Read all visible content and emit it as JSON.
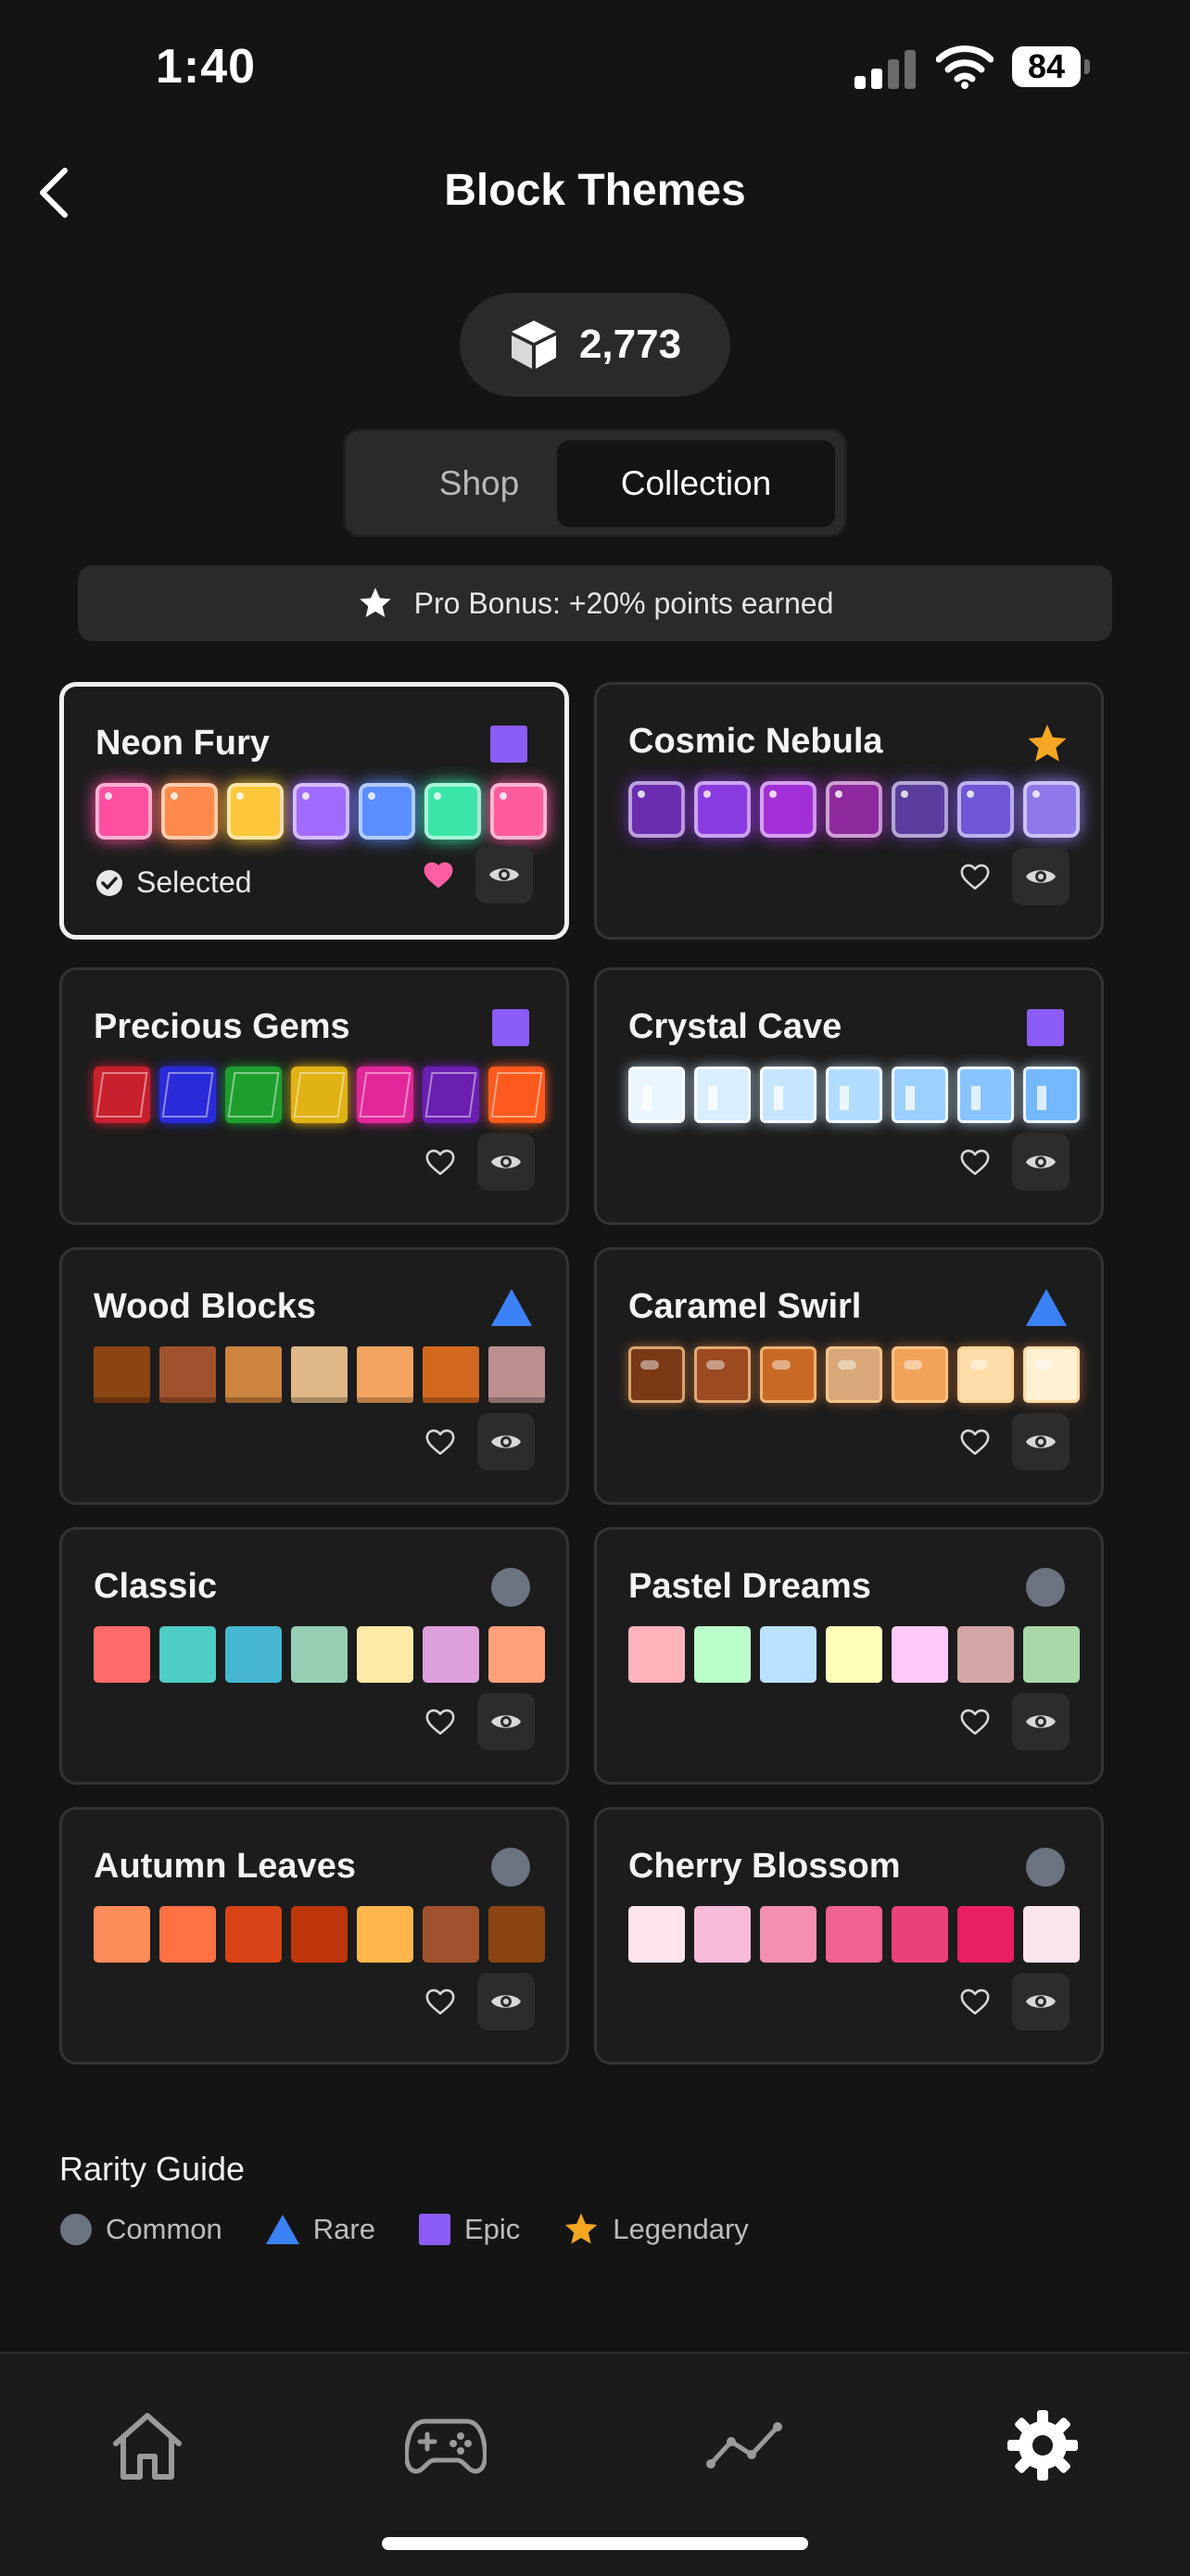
{
  "status_bar": {
    "time": "1:40",
    "battery": "84"
  },
  "header": {
    "title": "Block Themes"
  },
  "points": {
    "value": "2,773"
  },
  "segments": {
    "shop": "Shop",
    "collection": "Collection"
  },
  "bonus": {
    "text": "Pro Bonus: +20% points earned"
  },
  "colors": {
    "epic": "#8B5CF6",
    "rare": "#3B82F6",
    "legendary": "#F5A623",
    "common": "#6B7280",
    "favorite": "#FF5FA2"
  },
  "themes": [
    {
      "name": "Neon Fury",
      "rarity": "epic",
      "status": "Selected",
      "favorited": true,
      "swatches": [
        "#FF4FA0",
        "#FF8A4C",
        "#FFC83A",
        "#A06BFF",
        "#5A8DFF",
        "#39E6A8",
        "#FF5C9E"
      ]
    },
    {
      "name": "Cosmic Nebula",
      "rarity": "legendary",
      "favorited": false,
      "swatches": [
        "#6A2DB0",
        "#8A3BE0",
        "#A22FD8",
        "#8E2A9E",
        "#5B3D9E",
        "#6E56D6",
        "#8E78E8"
      ]
    },
    {
      "name": "Precious Gems",
      "rarity": "epic",
      "favorited": false,
      "swatches": [
        "#C8202C",
        "#2A2BD8",
        "#1E9E2E",
        "#E0B214",
        "#E2279A",
        "#6A1FB0",
        "#FF5A1E"
      ]
    },
    {
      "name": "Crystal Cave",
      "rarity": "epic",
      "favorited": false,
      "swatches": [
        "#EAF6FF",
        "#D9EEFF",
        "#C6E6FF",
        "#B2DCFF",
        "#9CD0FF",
        "#88C4FF",
        "#74B8FF"
      ]
    },
    {
      "name": "Wood Blocks",
      "rarity": "rare",
      "favorited": false,
      "swatches": [
        "#8B4513",
        "#A0522D",
        "#CD853F",
        "#DEB887",
        "#F4A460",
        "#D2691E",
        "#BC8F8F"
      ]
    },
    {
      "name": "Caramel Swirl",
      "rarity": "rare",
      "favorited": false,
      "swatches": [
        "#7A3A16",
        "#9C4A22",
        "#C86A26",
        "#D9A878",
        "#F2A35A",
        "#FFDDA8",
        "#FFF1D2"
      ]
    },
    {
      "name": "Classic",
      "rarity": "common",
      "favorited": false,
      "swatches": [
        "#FF6B6B",
        "#4ECDC4",
        "#45B7D1",
        "#96CEB4",
        "#FFEAA7",
        "#DDA0DD",
        "#FFA07A"
      ]
    },
    {
      "name": "Pastel Dreams",
      "rarity": "common",
      "favorited": false,
      "swatches": [
        "#FFB3BA",
        "#BAFFC9",
        "#BAE1FF",
        "#FFFFBA",
        "#FFC9F9",
        "#D4A5A5",
        "#A8D8A8"
      ]
    },
    {
      "name": "Autumn Leaves",
      "rarity": "common",
      "favorited": false,
      "swatches": [
        "#FF8C5A",
        "#FF7043",
        "#D84315",
        "#BF360C",
        "#FFB74D",
        "#A0522D",
        "#8B4513"
      ]
    },
    {
      "name": "Cherry Blossom",
      "rarity": "common",
      "favorited": false,
      "swatches": [
        "#FFE4EC",
        "#F8BBD9",
        "#F48FB1",
        "#F06292",
        "#EC407A",
        "#E91E63",
        "#FCE4EC"
      ]
    }
  ],
  "rarity_guide": {
    "title": "Rarity Guide",
    "items": [
      {
        "label": "Common",
        "icon": "circle-icon"
      },
      {
        "label": "Rare",
        "icon": "triangle-icon"
      },
      {
        "label": "Epic",
        "icon": "square-icon"
      },
      {
        "label": "Legendary",
        "icon": "star-icon"
      }
    ]
  },
  "tab_bar": {
    "items": [
      "home",
      "games",
      "stats",
      "settings"
    ],
    "active": "settings"
  }
}
